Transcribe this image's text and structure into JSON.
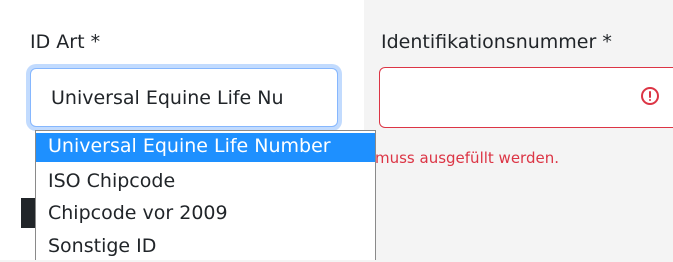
{
  "form": {
    "id_art": {
      "label": "ID Art *",
      "selected_value": "Universal Equine Life Nu"
    },
    "id_number": {
      "label": "Identifikationsnummer *",
      "value": "",
      "error_icon": "exclamation-circle-icon",
      "error_message": "muss ausgefüllt werden."
    }
  },
  "dropdown": {
    "options": [
      {
        "label": "Universal Equine Life Number",
        "selected": true
      },
      {
        "label": "ISO Chipcode",
        "selected": false
      },
      {
        "label": "Chipcode vor 2009",
        "selected": false
      },
      {
        "label": "Sonstige ID",
        "selected": false
      }
    ]
  },
  "colors": {
    "accent": "#1e90ff",
    "error": "#dc3545",
    "focus_border": "#86b7fe"
  }
}
